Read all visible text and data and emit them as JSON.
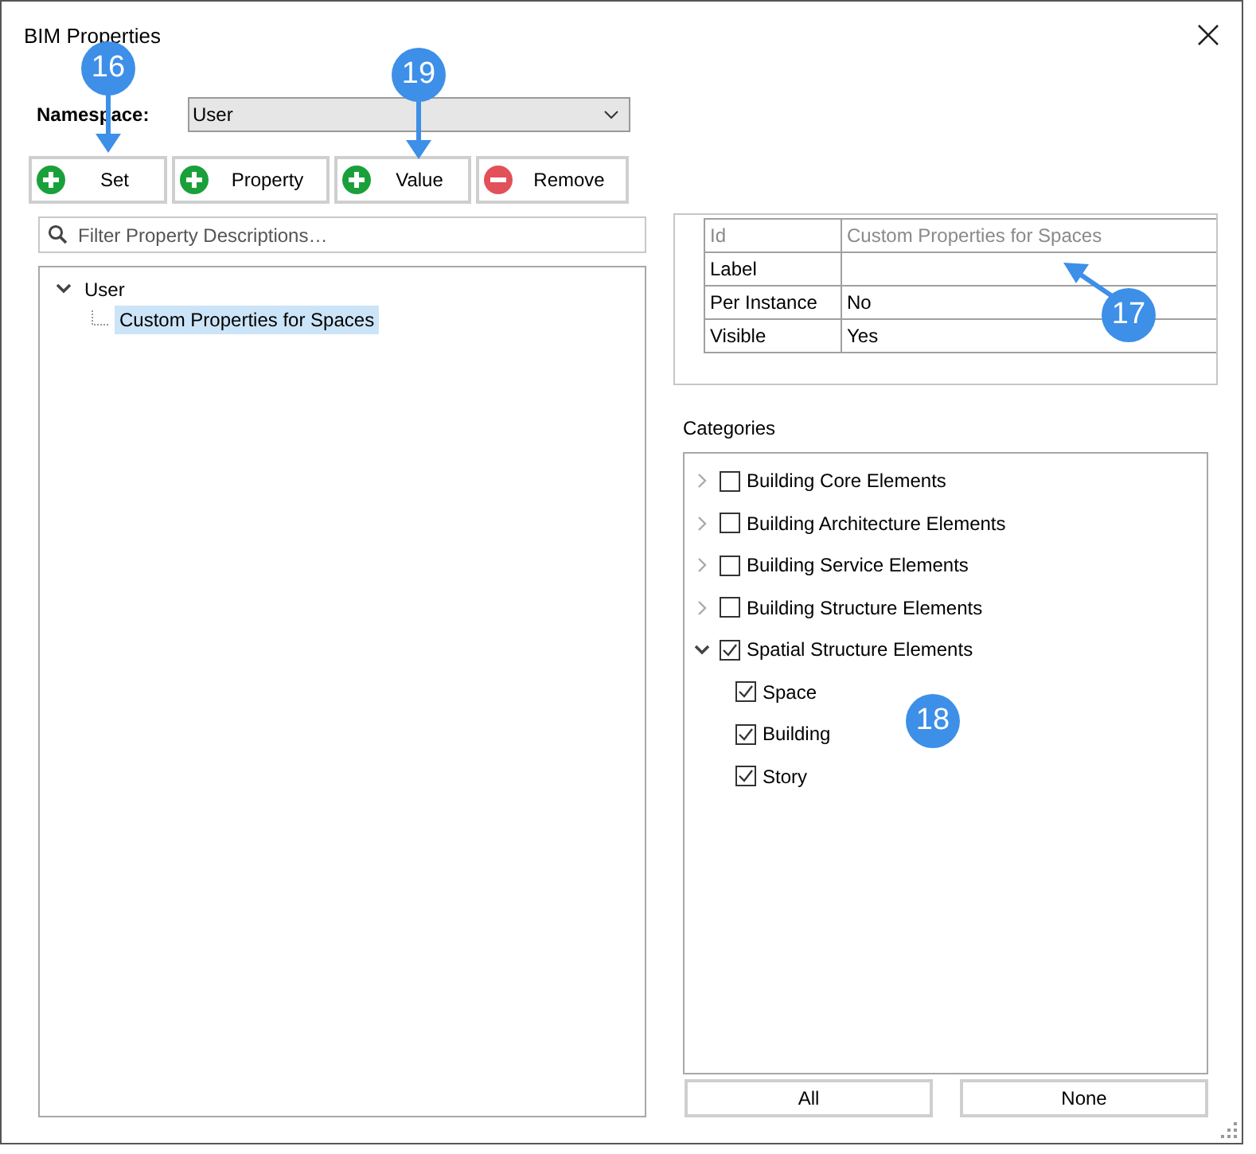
{
  "window": {
    "title": "BIM Properties"
  },
  "namespace": {
    "label": "Namespace:",
    "value": "User"
  },
  "toolbar": [
    {
      "label": "Set",
      "kind": "add"
    },
    {
      "label": "Property",
      "kind": "add"
    },
    {
      "label": "Value",
      "kind": "add"
    },
    {
      "label": "Remove",
      "kind": "remove"
    }
  ],
  "filter": {
    "placeholder": "Filter Property Descriptions…"
  },
  "tree": [
    {
      "label": "User",
      "expanded": true,
      "selected": false,
      "children": [
        {
          "label": "Custom Properties for Spaces",
          "selected": true
        }
      ]
    }
  ],
  "properties": [
    {
      "name": "Id",
      "value": "Custom Properties for Spaces",
      "disabled": true
    },
    {
      "name": "Label",
      "disabled": false
    },
    {
      "name": "Per Instance",
      "value": "No",
      "disabled": false
    },
    {
      "name": "Visible",
      "value": "Yes",
      "disabled": false
    }
  ],
  "categories": {
    "label": "Categories",
    "items": [
      {
        "label": "Building Core Elements",
        "checked": false,
        "expanded": false
      },
      {
        "label": "Building Architecture Elements",
        "checked": false,
        "expanded": false
      },
      {
        "label": "Building Service Elements",
        "checked": false,
        "expanded": false
      },
      {
        "label": "Building Structure Elements",
        "checked": false,
        "expanded": false
      },
      {
        "label": "Spatial Structure Elements",
        "checked": true,
        "expanded": true,
        "children": [
          {
            "label": "Space",
            "checked": true
          },
          {
            "label": "Building",
            "checked": true
          },
          {
            "label": "Story",
            "checked": true
          }
        ]
      }
    ]
  },
  "buttons": [
    "All",
    "None"
  ],
  "callouts": [
    {
      "number": "16",
      "kind": "down"
    },
    {
      "number": "19",
      "kind": "down"
    },
    {
      "number": "17",
      "kind": "up-left"
    },
    {
      "number": "18",
      "kind": "none"
    }
  ]
}
